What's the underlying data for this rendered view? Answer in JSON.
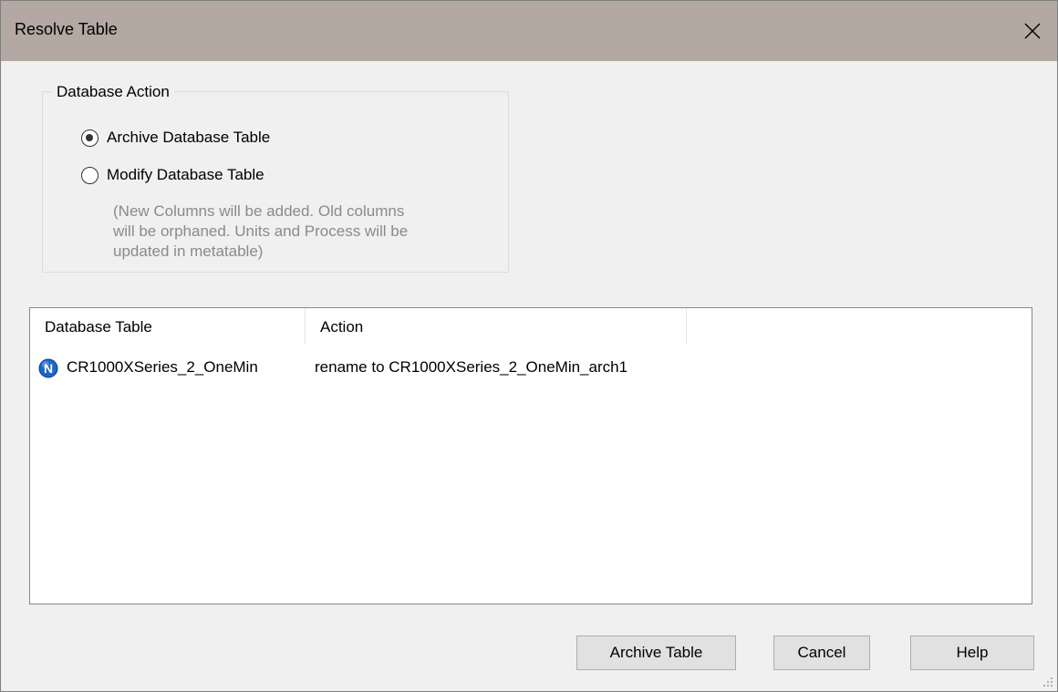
{
  "window": {
    "title": "Resolve Table"
  },
  "database_action": {
    "legend": "Database Action",
    "options": [
      {
        "label": "Archive Database Table",
        "selected": true
      },
      {
        "label": "Modify Database Table",
        "selected": false
      }
    ],
    "note_lines": [
      "(New Columns will be added.  Old columns",
      "will be orphaned.  Units and Process will be",
      "updated in metatable)"
    ]
  },
  "table": {
    "columns": [
      "Database Table",
      "Action"
    ],
    "rows": [
      {
        "icon": "network-node-icon",
        "icon_letter": "N",
        "database_table": "CR1000XSeries_2_OneMin",
        "action": "rename to CR1000XSeries_2_OneMin_arch1"
      }
    ]
  },
  "buttons": {
    "archive": "Archive Table",
    "cancel": "Cancel",
    "help": "Help"
  },
  "colors": {
    "titlebar": "#b3a8a2",
    "dialog_bg": "#f0f0f0",
    "icon_blue": "#1a66cc"
  }
}
